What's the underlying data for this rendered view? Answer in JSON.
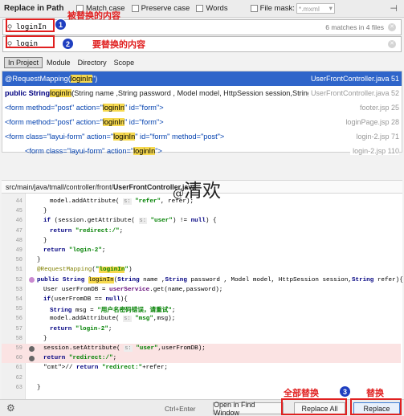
{
  "header": {
    "title": "Replace in Path",
    "match_case": "Match case",
    "preserve_case": "Preserve case",
    "words": "Words",
    "file_mask": "File mask:",
    "file_mask_value": "*.mxml",
    "pin_icon": "pin-icon"
  },
  "search": {
    "find_value": "loginIn",
    "replace_value": "login",
    "matches": "6 matches in 4 files"
  },
  "annotations": {
    "find_note": "被替换的内容",
    "replace_note": "要替换的内容",
    "replace_all_note": "全部替换",
    "replace_note_btn": "替换",
    "badge1": "1",
    "badge2": "2",
    "badge3": "3"
  },
  "scope_tabs": [
    "In Project",
    "Module",
    "Directory",
    "Scope"
  ],
  "results": [
    {
      "pre": "@RequestMapping(",
      "match": "loginIn",
      "post": "\")",
      "loc": "UserFrontController.java 51"
    },
    {
      "pre": "public String ",
      "match": "loginIn",
      "post": "(String name ,String password , Model model, HttpSession session,String refe",
      "loc": "UserFrontController.java 52"
    },
    {
      "pre": "<form method=\"post\" action=\"",
      "match": "loginIn",
      "post": "\" id=\"form\">",
      "loc": "footer.jsp 25"
    },
    {
      "pre": "<form method=\"post\" action=\"",
      "match": "loginIn",
      "post": "\" id=\"form\">",
      "loc": "loginPage.jsp 28"
    },
    {
      "pre": "<form class=\"layui-form\" action=\"",
      "match": "loginIn",
      "post": "\" id=\"form\"  method=\"post\">",
      "loc": "login-2.jsp 71"
    },
    {
      "pre": "<form class=\"layui-form\" action=\"",
      "match": "loginIn",
      "post": "\">",
      "loc": "login-2.jsp 110"
    }
  ],
  "file_path": {
    "prefix": "src/main/java/tmall/controller/front/",
    "file": "UserFrontController.java"
  },
  "code_lines": [
    {
      "n": "44",
      "text": "model.addAttribute( s: \"refer\", refer);"
    },
    {
      "n": "45",
      "text": "}"
    },
    {
      "n": "46",
      "text": "if (session.getAttribute( s: \"user\") != null) {"
    },
    {
      "n": "47",
      "text": "return \"redirect:/\";"
    },
    {
      "n": "48",
      "text": "}"
    },
    {
      "n": "49",
      "text": "return \"login-2\";"
    },
    {
      "n": "50",
      "text": "}"
    },
    {
      "n": "51",
      "text": "@RequestMapping(\"loginIn\")"
    },
    {
      "n": "52",
      "text": "public String loginIn(String name ,String password , Model model, HttpSession session,String refer){"
    },
    {
      "n": "53",
      "text": "User userFromDB = userService.get(name,password);"
    },
    {
      "n": "54",
      "text": "if(userFromDB == null){"
    },
    {
      "n": "55",
      "text": "String msg = \"用户名密码错误，请重试\";"
    },
    {
      "n": "56",
      "text": "model.addAttribute( s: \"msg\",msg);"
    },
    {
      "n": "57",
      "text": "return \"login-2\";"
    },
    {
      "n": "58",
      "text": "}"
    },
    {
      "n": "59",
      "text": "session.setAttribute( s: \"user\",userFromDB);"
    },
    {
      "n": "60",
      "text": "return \"redirect:/\";"
    },
    {
      "n": "61",
      "text": "// return \"redirect:\"+refer;"
    },
    {
      "n": "62",
      "text": ""
    },
    {
      "n": "63",
      "text": "}"
    }
  ],
  "watermark": {
    "at": "@",
    "text": "清欢"
  },
  "footer": {
    "shortcut": "Ctrl+Enter",
    "open_in_find_window": "Open in Find Window",
    "replace_all": "Replace All",
    "replace": "Replace"
  },
  "colors": {
    "annotation_red": "#e02020",
    "badge_blue": "#1f3fc0",
    "selection_blue": "#2f65ca",
    "match_yellow": "#f6d94f"
  }
}
